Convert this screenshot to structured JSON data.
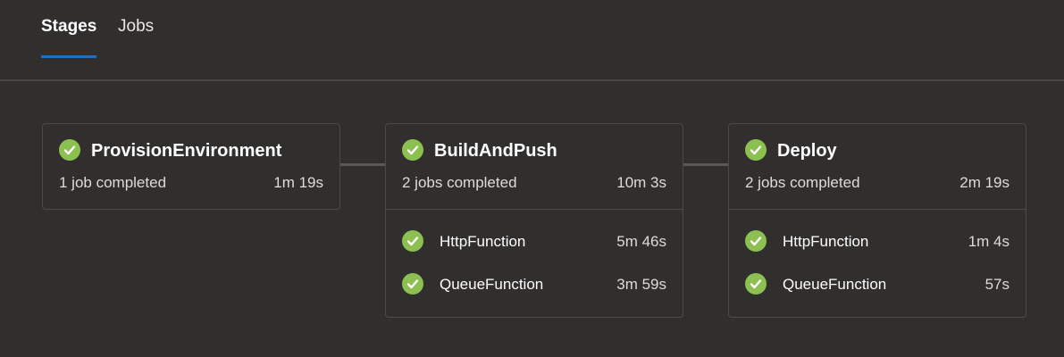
{
  "tabs": [
    {
      "label": "Stages",
      "active": true
    },
    {
      "label": "Jobs",
      "active": false
    }
  ],
  "colors": {
    "success": "#8cc152",
    "accent": "#1f6fc4",
    "background": "#302f2d"
  },
  "stages": [
    {
      "name": "ProvisionEnvironment",
      "status": "1 job completed",
      "duration": "1m 19s",
      "icon": "check-circle-icon",
      "jobs": []
    },
    {
      "name": "BuildAndPush",
      "status": "2 jobs completed",
      "duration": "10m 3s",
      "icon": "check-circle-icon",
      "jobs": [
        {
          "name": "HttpFunction",
          "duration": "5m 46s"
        },
        {
          "name": "QueueFunction",
          "duration": "3m 59s"
        }
      ]
    },
    {
      "name": "Deploy",
      "status": "2 jobs completed",
      "duration": "2m 19s",
      "icon": "check-circle-icon",
      "jobs": [
        {
          "name": "HttpFunction",
          "duration": "1m 4s"
        },
        {
          "name": "QueueFunction",
          "duration": "57s"
        }
      ]
    }
  ]
}
